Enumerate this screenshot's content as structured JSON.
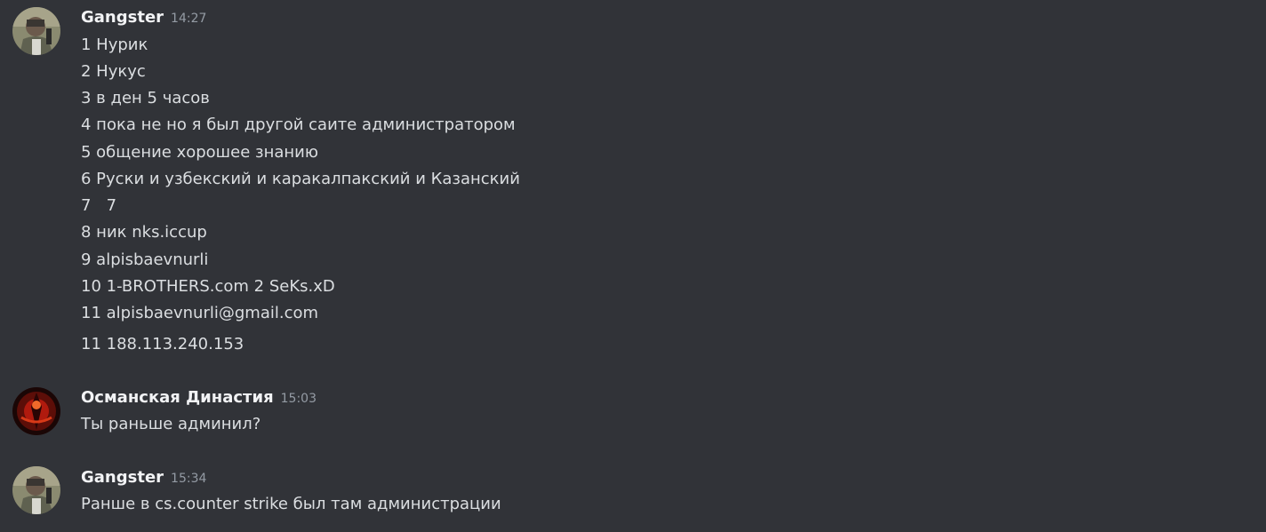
{
  "messages": [
    {
      "username": "Gangster",
      "timestamp": "14:27",
      "lines": [
        "1 Нурик",
        "2 Нукус",
        "3 в ден 5 часов",
        "4 пока не но я был другой саите администратором",
        "5 общение хорошее знанию",
        "6 Руски и узбекский и каракалпакский и Казанский",
        "7   7",
        "8 ник nks.iccup",
        "9 alpisbaevnurli",
        "10 1-BROTHERS.com 2 SeKs.xD",
        "11 alpisbaevnurli@gmail.com",
        "11 188.113.240.153"
      ]
    },
    {
      "username": "Османская Династия",
      "timestamp": "15:03",
      "lines": [
        "Ты раньше админил?"
      ]
    },
    {
      "username": "Gangster",
      "timestamp": "15:34",
      "lines": [
        "Ранше в cs.counter strike был там администрации"
      ]
    }
  ],
  "colors": {
    "background": "#313338",
    "username": "#f2f3f5",
    "timestamp": "#949ba4",
    "message_text": "#dbdee1"
  }
}
